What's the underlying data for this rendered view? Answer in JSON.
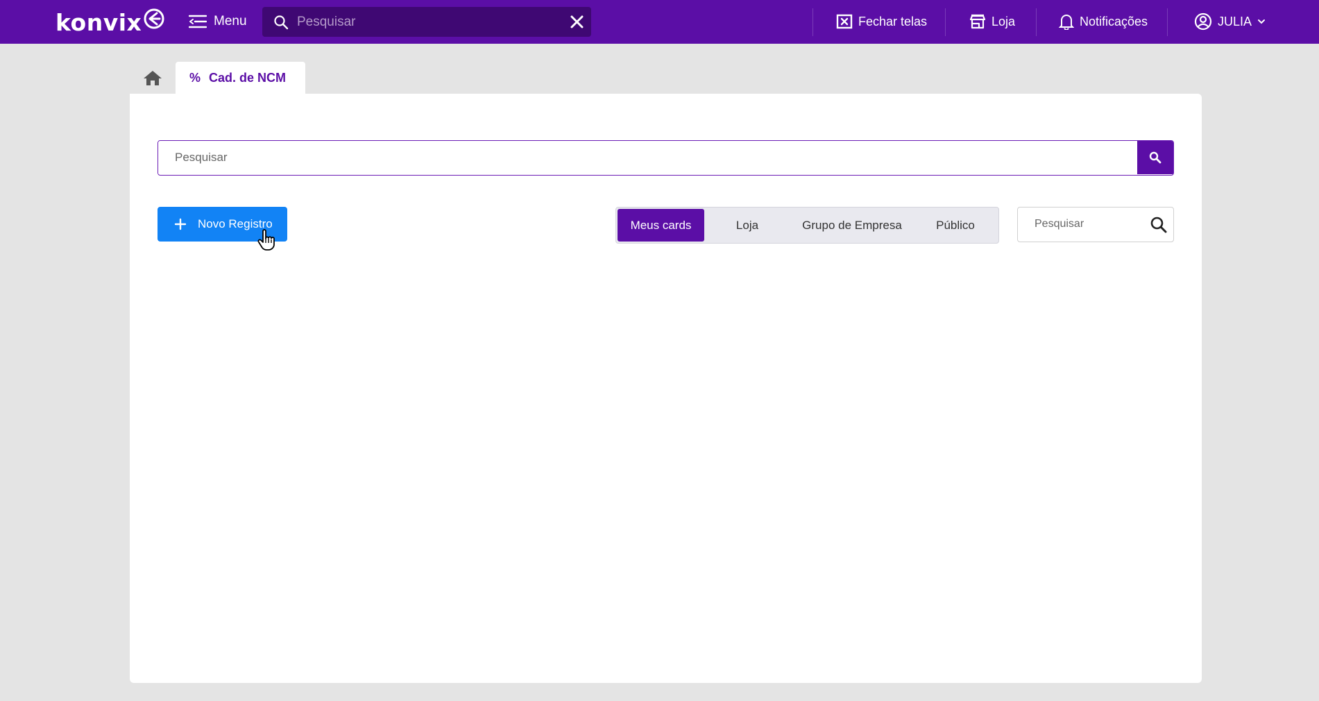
{
  "topbar": {
    "logo_text": "konvix",
    "menu_label": "Menu",
    "search_placeholder": "Pesquisar",
    "close_screens_label": "Fechar telas",
    "store_label": "Loja",
    "notifications_label": "Notificações",
    "user_label": "JULIA"
  },
  "tabs": {
    "home_icon": "home-icon",
    "active_tab_icon": "%",
    "active_tab_label": "Cad. de NCM"
  },
  "main": {
    "search_placeholder": "Pesquisar",
    "new_record_label": "Novo Registro",
    "scope_filters": [
      {
        "label": "Meus cards",
        "active": true
      },
      {
        "label": "Loja",
        "active": false
      },
      {
        "label": "Grupo de Empresa",
        "active": false
      },
      {
        "label": "Público",
        "active": false
      }
    ],
    "filter_search_placeholder": "Pesquisar"
  },
  "colors": {
    "brand": "#5b0ea6",
    "primary_button": "#1283f5",
    "background": "#e4e4e4"
  }
}
